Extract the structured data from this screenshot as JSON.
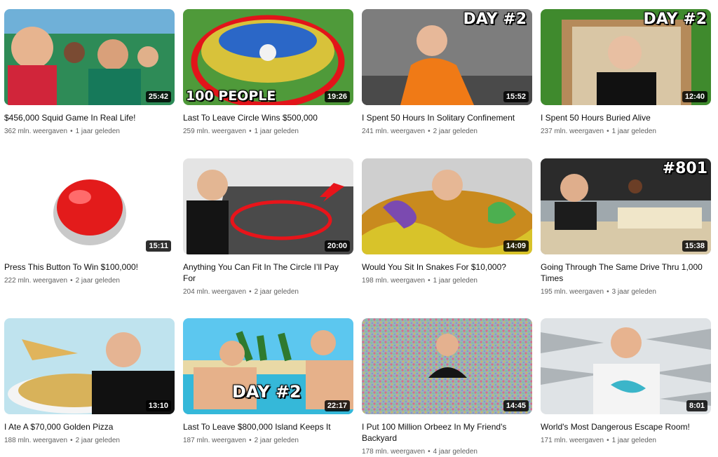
{
  "videos": [
    {
      "title": "$456,000 Squid Game In Real Life!",
      "views": "362 mln. weergaven",
      "age": "1 jaar geleden",
      "duration": "25:42",
      "overlay": ""
    },
    {
      "title": "Last To Leave Circle Wins $500,000",
      "views": "259 mln. weergaven",
      "age": "1 jaar geleden",
      "duration": "19:26",
      "overlay": "100 PEOPLE"
    },
    {
      "title": "I Spent 50 Hours In Solitary Confinement",
      "views": "241 mln. weergaven",
      "age": "2 jaar geleden",
      "duration": "15:52",
      "overlay": "DAY #2"
    },
    {
      "title": "I Spent 50 Hours Buried Alive",
      "views": "237 mln. weergaven",
      "age": "1 jaar geleden",
      "duration": "12:40",
      "overlay": "DAY #2"
    },
    {
      "title": "Press This Button To Win $100,000!",
      "views": "222 mln. weergaven",
      "age": "2 jaar geleden",
      "duration": "15:11",
      "overlay": ""
    },
    {
      "title": "Anything You Can Fit In The Circle I’ll Pay For",
      "views": "204 mln. weergaven",
      "age": "2 jaar geleden",
      "duration": "20:00",
      "overlay": ""
    },
    {
      "title": "Would You Sit In Snakes For $10,000?",
      "views": "198 mln. weergaven",
      "age": "1 jaar geleden",
      "duration": "14:09",
      "overlay": ""
    },
    {
      "title": "Going Through The Same Drive Thru 1,000 Times",
      "views": "195 mln. weergaven",
      "age": "3 jaar geleden",
      "duration": "15:38",
      "overlay": "#801"
    },
    {
      "title": "I Ate A $70,000 Golden Pizza",
      "views": "188 mln. weergaven",
      "age": "2 jaar geleden",
      "duration": "13:10",
      "overlay": ""
    },
    {
      "title": "Last To Leave $800,000 Island Keeps It",
      "views": "187 mln. weergaven",
      "age": "2 jaar geleden",
      "duration": "22:17",
      "overlay": "DAY #2"
    },
    {
      "title": "I Put 100 Million Orbeez In My Friend's Backyard",
      "views": "178 mln. weergaven",
      "age": "4 jaar geleden",
      "duration": "14:45",
      "overlay": ""
    },
    {
      "title": "World's Most Dangerous Escape Room!",
      "views": "171 mln. weergaven",
      "age": "1 jaar geleden",
      "duration": "8:01",
      "overlay": ""
    }
  ],
  "meta_separator": "•",
  "colors": {
    "text_primary": "#0f0f0f",
    "text_secondary": "#606060",
    "duration_bg": "#000000"
  }
}
